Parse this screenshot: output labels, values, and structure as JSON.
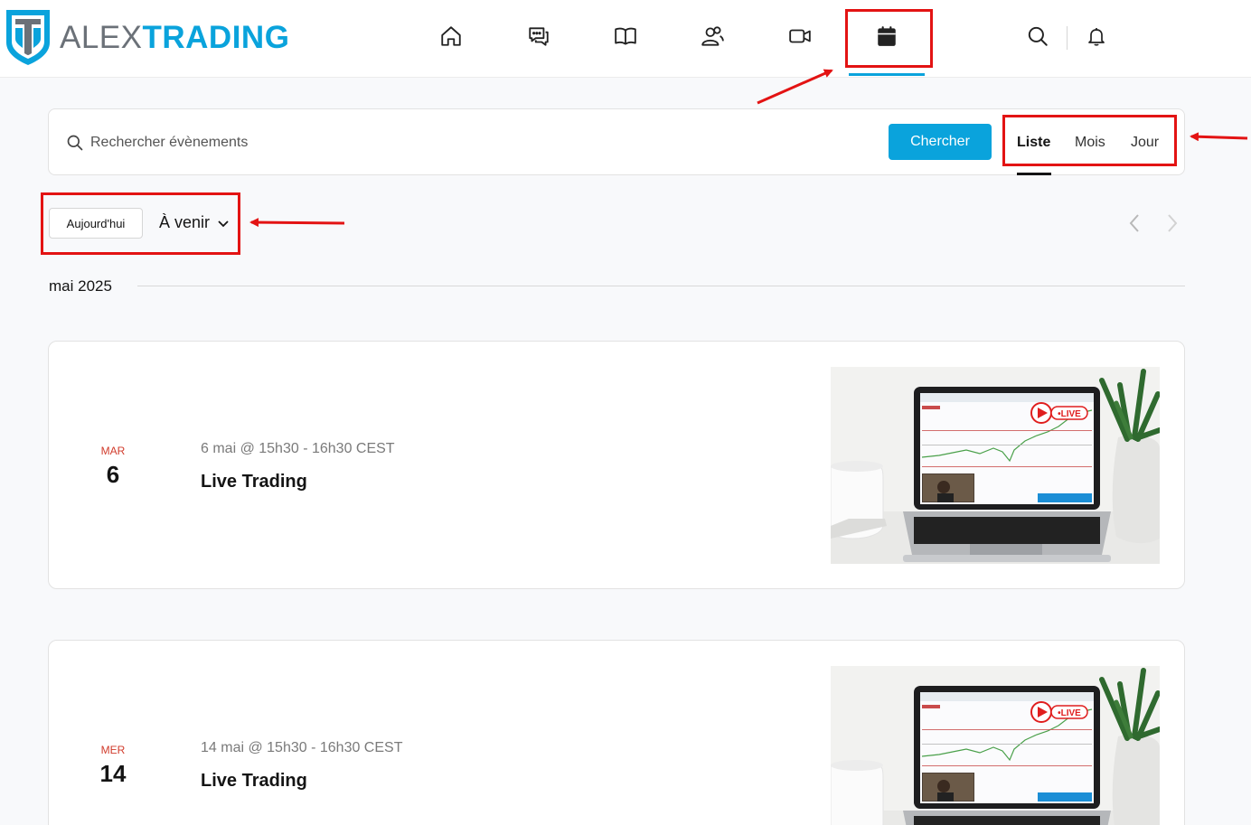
{
  "header": {
    "logo_alex": "ALEX",
    "logo_trading": "TRADING",
    "nav": [
      {
        "name": "home-icon"
      },
      {
        "name": "chat-icon"
      },
      {
        "name": "book-icon"
      },
      {
        "name": "users-icon"
      },
      {
        "name": "video-icon"
      },
      {
        "name": "calendar-icon",
        "active": true
      }
    ],
    "right_icons": [
      "search-icon",
      "bell-icon"
    ]
  },
  "search": {
    "placeholder": "Rechercher évènements",
    "button_label": "Chercher"
  },
  "views": {
    "tabs": [
      "Liste",
      "Mois",
      "Jour"
    ],
    "active": "Liste"
  },
  "controls": {
    "today_label": "Aujourd'hui",
    "range_label": "À venir"
  },
  "month_label": "mai 2025",
  "events": [
    {
      "day_abbr": "MAR",
      "day_num": "6",
      "time": "6 mai @ 15h30 - 16h30 CEST",
      "title": "Live Trading",
      "thumb_badge": "•LIVE"
    },
    {
      "day_abbr": "MER",
      "day_num": "14",
      "time": "14 mai @ 15h30 - 16h30 CEST",
      "title": "Live Trading",
      "thumb_badge": "•LIVE"
    }
  ],
  "colors": {
    "brand_blue": "#0aa3dc",
    "logo_gray": "#6b7178",
    "date_red": "#d13b2b",
    "annotation_red": "#e31313"
  }
}
